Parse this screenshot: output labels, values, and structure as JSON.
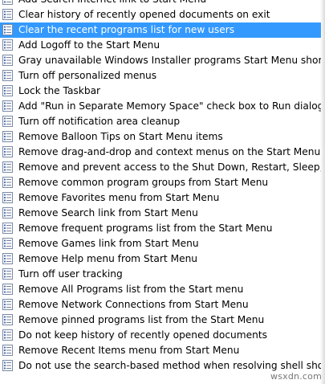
{
  "policy_list": {
    "selected_index": 2,
    "item_icon": "policy-setting-icon",
    "items": [
      "Add Search Internet link to Start Menu",
      "Clear history of recently opened documents on exit",
      "Clear the recent programs list for new users",
      "Add Logoff to the Start Menu",
      "Gray unavailable Windows Installer programs Start Menu shortcuts",
      "Turn off personalized menus",
      "Lock the Taskbar",
      "Add \"Run in Separate Memory Space\" check box to Run dialog box",
      "Turn off notification area cleanup",
      "Remove Balloon Tips on Start Menu items",
      "Remove drag-and-drop and context menus on the Start Menu",
      "Remove and prevent access to the Shut Down, Restart, Sleep, and Hibern",
      "Remove common program groups from Start Menu",
      "Remove Favorites menu from Start Menu",
      "Remove Search link from Start Menu",
      "Remove frequent programs list from the Start Menu",
      "Remove Games link from Start Menu",
      "Remove Help menu from Start Menu",
      "Turn off user tracking",
      "Remove All Programs list from the Start menu",
      "Remove Network Connections from Start Menu",
      "Remove pinned programs list from the Start Menu",
      "Do not keep history of recently opened documents",
      "Remove Recent Items menu from Start Menu",
      "Do not use the search-based method when resolving shell shortcuts"
    ]
  },
  "watermark": "wsxdn.com",
  "colors": {
    "selection": "#3399ff",
    "selection_text": "#ffffff"
  }
}
